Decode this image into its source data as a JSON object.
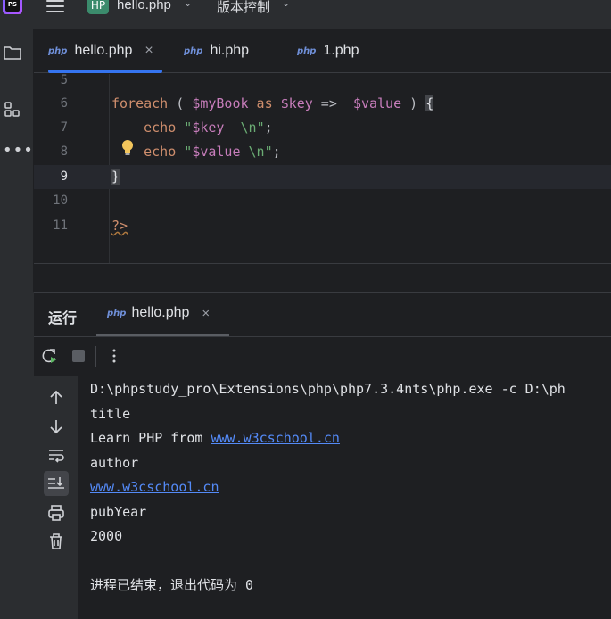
{
  "titlebar": {
    "app_logo_text": "PS",
    "project_badge": "HP",
    "project_name": "hello.php",
    "vcs_menu": "版本控制"
  },
  "toolstrip": {
    "icons": [
      "folder-icon",
      "structure-icon",
      "more-icon"
    ]
  },
  "editor_tabs": [
    {
      "icon_text": "php",
      "label": "hello.php",
      "active": true,
      "close": "×"
    },
    {
      "icon_text": "php",
      "label": "hi.php",
      "active": false
    },
    {
      "icon_text": "php",
      "label": "1.php",
      "active": false
    }
  ],
  "editor": {
    "current_line": 9,
    "lines": [
      {
        "num": "5"
      },
      {
        "num": "6",
        "tokens": [
          "foreach",
          " ( ",
          "$myBook",
          " as ",
          "$key",
          " =>  ",
          "$value",
          " ) ",
          "{"
        ]
      },
      {
        "num": "7",
        "tokens": [
          "echo",
          " ",
          "\"",
          "$key",
          "  \\n",
          "\"",
          ";"
        ]
      },
      {
        "num": "8",
        "tokens": [
          "echo",
          " ",
          "\"",
          "$value",
          " \\n",
          "\"",
          ";"
        ]
      },
      {
        "num": "9",
        "tokens": [
          "}"
        ]
      },
      {
        "num": "10"
      },
      {
        "num": "11",
        "tokens": [
          "?>"
        ]
      }
    ]
  },
  "run_panel": {
    "title": "运行",
    "tab_icon_text": "php",
    "tab_label": "hello.php",
    "tab_close": "×"
  },
  "console": {
    "command": "D:\\phpstudy_pro\\Extensions\\php\\php7.3.4nts\\php.exe -c D:\\ph",
    "lines": [
      {
        "text": "title"
      },
      {
        "prefix": "Learn PHP from ",
        "link": "www.w3cschool.cn"
      },
      {
        "text": "author"
      },
      {
        "link": "www.w3cschool.cn"
      },
      {
        "text": "pubYear"
      },
      {
        "text": "2000"
      },
      {
        "text": ""
      },
      {
        "text": "进程已结束，退出代码为 0"
      }
    ]
  },
  "colors": {
    "accent": "#3574f0",
    "keyword": "#cf8e6d",
    "variable": "#c77dbb",
    "string": "#6aab73",
    "link": "#548af7",
    "project_badge": "#3b8b6c"
  }
}
